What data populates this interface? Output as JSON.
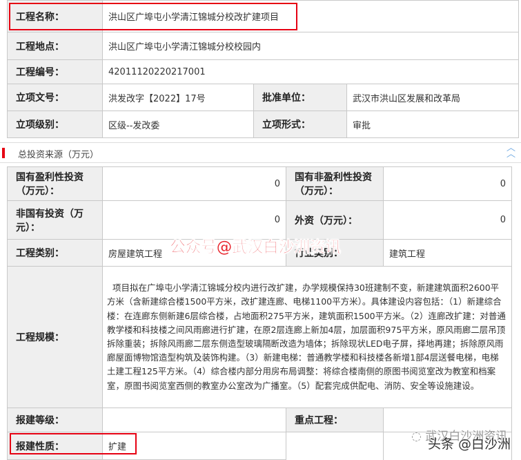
{
  "project": {
    "rows": [
      {
        "label": "工程名称：",
        "value": "洪山区广埠屯小学清江锦城分校改扩建项目"
      },
      {
        "label": "工程地点：",
        "value": "洪山区广埠屯小学清江锦城分校校园内"
      },
      {
        "label": "工程编号：",
        "value": "42011120220217001"
      }
    ],
    "approval_no": {
      "label": "立项文号：",
      "value": "洪发改字【2022】17号"
    },
    "approval_unit": {
      "label": "批准单位：",
      "value": "武汉市洪山区发展和改革局"
    },
    "level": {
      "label": "立项级别：",
      "value": "区级--发改委"
    },
    "form": {
      "label": "立项形式：",
      "value": "审批"
    }
  },
  "section": {
    "title": "总投资来源（万元）",
    "collapse_icon": "double-chevron-up-icon"
  },
  "investment": {
    "state_profit": {
      "label": "国有盈利性投资（万元）：",
      "value": "0"
    },
    "state_nonprofit": {
      "label": "国有非盈利性投资（万元）：",
      "value": "0"
    },
    "non_state": {
      "label": "非国有投资（万元）：",
      "value": "0"
    },
    "foreign": {
      "label": "外资（万元）：",
      "value": "0"
    },
    "category": {
      "label": "工程类别：",
      "value": "房屋建筑工程"
    },
    "industry": {
      "label": "行业类别：",
      "value": "建筑工程"
    },
    "scale": {
      "label": "工程规模：",
      "value": "  项目拟在广埠屯小学清江锦城分校内进行改扩建，办学规模保持30班建制不变，新建建筑面积2600平方米（含新建综合楼1500平方米，改扩建连廊、电梯1100平方米）。具体建设内容包括：（1）新建综合楼：在连廊东侧新建6层综合楼，占地面积275平方米，建筑面积1500平方米。（2）连廊改扩建：对普通教学楼和科技楼之间风雨廊进行扩建，在原2层连廊上新加4层，加层面积975平方米，原风雨廊二层吊顶拆除重装；拆除风雨廊二层东侧造型玻璃隔断改造为墙体；拆除现状LED电子屏，择地再建；拆除原风雨廊屋面博物馆造型构筑及装饰构建。（3）新建电梯：普通教学楼和科技楼各新增1部4层送餐电梯，电梯土建工程125平方米。（4）综合楼内部分用房布局调整：将综合楼南侧的原图书阅览室改为教室和档案室，原图书阅览室西侧的教室办公室改为广播室。（5）配套完成供配电、消防、安全等设施建设。"
    },
    "report_level": {
      "label": "报建等级：",
      "value": ""
    },
    "key_project": {
      "label": "重点工程：",
      "value": ""
    },
    "report_nature": {
      "label": "报建性质：",
      "value": "扩建"
    }
  },
  "watermarks": {
    "main": "公众号@武汉白沙洲资讯",
    "corner_top": "武汉白沙洲资讯",
    "corner_bottom": "头条 @白沙洲"
  }
}
